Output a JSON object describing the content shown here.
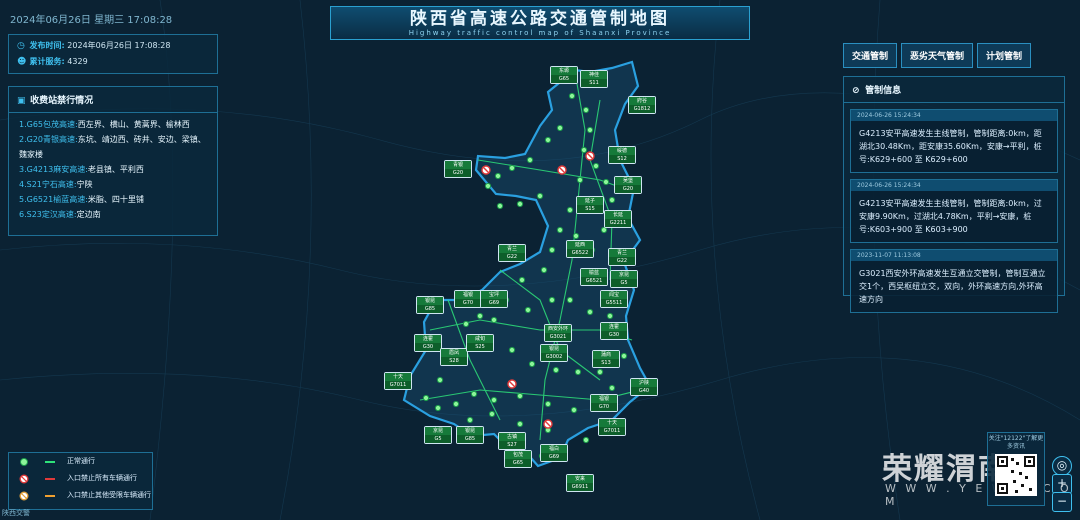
{
  "header": {
    "datetime": "2024年06月26日 星期三  17:08:28",
    "title": "陕西省高速公路交通管制地图",
    "subtitle": "Highway traffic control map of Shaanxi Province"
  },
  "publish": {
    "time_label": "发布时间:",
    "time_value": "2024年06月26日 17:08:28",
    "service_label": "累计服务:",
    "service_value": "4329"
  },
  "toll": {
    "title": "收费站禁行情况",
    "items": [
      {
        "road": "1.G65包茂高速:",
        "places": "西左界、横山、黄蒿界、榆林西"
      },
      {
        "road": "2.G20青银高速:",
        "places": "东坑、靖边西、砖井、安边、梁镇、魏家楼"
      },
      {
        "road": "3.G4213麻安高速:",
        "places": "老县镇、平利西"
      },
      {
        "road": "4.S21宁石高速:",
        "places": "宁陕"
      },
      {
        "road": "5.G6521榆蓝高速:",
        "places": "米脂、四十里铺"
      },
      {
        "road": "6.S23定汉高速:",
        "places": "定边南"
      }
    ]
  },
  "tabs": [
    "交通管制",
    "恶劣天气管制",
    "计划管制"
  ],
  "control": {
    "title": "管制信息",
    "items": [
      {
        "time": "2024-06-26 15:24:34",
        "text": "G4213安平高速发生主线管制，管制距离:0km，距湖北30.48Km，距安康35.60Km，安康→平利，桩号:K629+600 至 K629+600"
      },
      {
        "time": "2024-06-26 15:24:34",
        "text": "G4213安平高速发生主线管制，管制距离:0km，过安康9.90Km，过湖北4.78Km，平利→安康，桩号:K603+900 至 K603+900"
      },
      {
        "time": "2023-11-07 11:13:08",
        "text": "G3021西安外环高速发生互通立交管制，管制互通立交1个，西吴枢纽立交，双向，外环高速方向,外环高速方向"
      }
    ]
  },
  "legend": {
    "items": [
      {
        "label": "正常通行"
      },
      {
        "label": "入口禁止所有车辆通行"
      },
      {
        "label": "入口禁止其他受限车辆通行"
      }
    ]
  },
  "signs": [
    {
      "name": "东塬",
      "code": "G65"
    },
    {
      "name": "神佳",
      "code": "S11"
    },
    {
      "name": "府谷",
      "code": "G1812"
    },
    {
      "name": "青银",
      "code": "G20"
    },
    {
      "name": "绥德",
      "code": "S12"
    },
    {
      "name": "吴堡",
      "code": "G20"
    },
    {
      "name": "延子",
      "code": "S15"
    },
    {
      "name": "长延",
      "code": "G2211"
    },
    {
      "name": "青兰",
      "code": "G22"
    },
    {
      "name": "延西",
      "code": "G6522"
    },
    {
      "name": "青兰",
      "code": "G22"
    },
    {
      "name": "榆蓝",
      "code": "G6521"
    },
    {
      "name": "京昆",
      "code": "G5"
    },
    {
      "name": "银昆",
      "code": "G85"
    },
    {
      "name": "福银",
      "code": "G70"
    },
    {
      "name": "宝坪",
      "code": "G69"
    },
    {
      "name": "闻宝",
      "code": "G5511"
    },
    {
      "name": "连霍",
      "code": "G30"
    },
    {
      "name": "眉凤",
      "code": "S28"
    },
    {
      "name": "咸旬",
      "code": "S25"
    },
    {
      "name": "连霍",
      "code": "G30"
    },
    {
      "name": "西安外环",
      "code": "G3021"
    },
    {
      "name": "银昆",
      "code": "G3002"
    },
    {
      "name": "蒲商",
      "code": "S13"
    },
    {
      "name": "十天",
      "code": "G7011"
    },
    {
      "name": "沪陕",
      "code": "G40"
    },
    {
      "name": "福银",
      "code": "G70"
    },
    {
      "name": "十天",
      "code": "G7011"
    },
    {
      "name": "京昆",
      "code": "G5"
    },
    {
      "name": "银昆",
      "code": "G85"
    },
    {
      "name": "古镇",
      "code": "S27"
    },
    {
      "name": "包茂",
      "code": "G65"
    },
    {
      "name": "福白",
      "code": "G69"
    },
    {
      "name": "安来",
      "code": "G6911"
    }
  ],
  "watermark": {
    "brand": "荣耀渭南",
    "url": "W W W . Y E W N . C O M"
  },
  "qr": {
    "caption": "关注\"12122\"了解更多资讯"
  },
  "brand_logo": "陕西交警",
  "zoom": {
    "locate": "◎",
    "plus": "+",
    "minus": "−"
  }
}
